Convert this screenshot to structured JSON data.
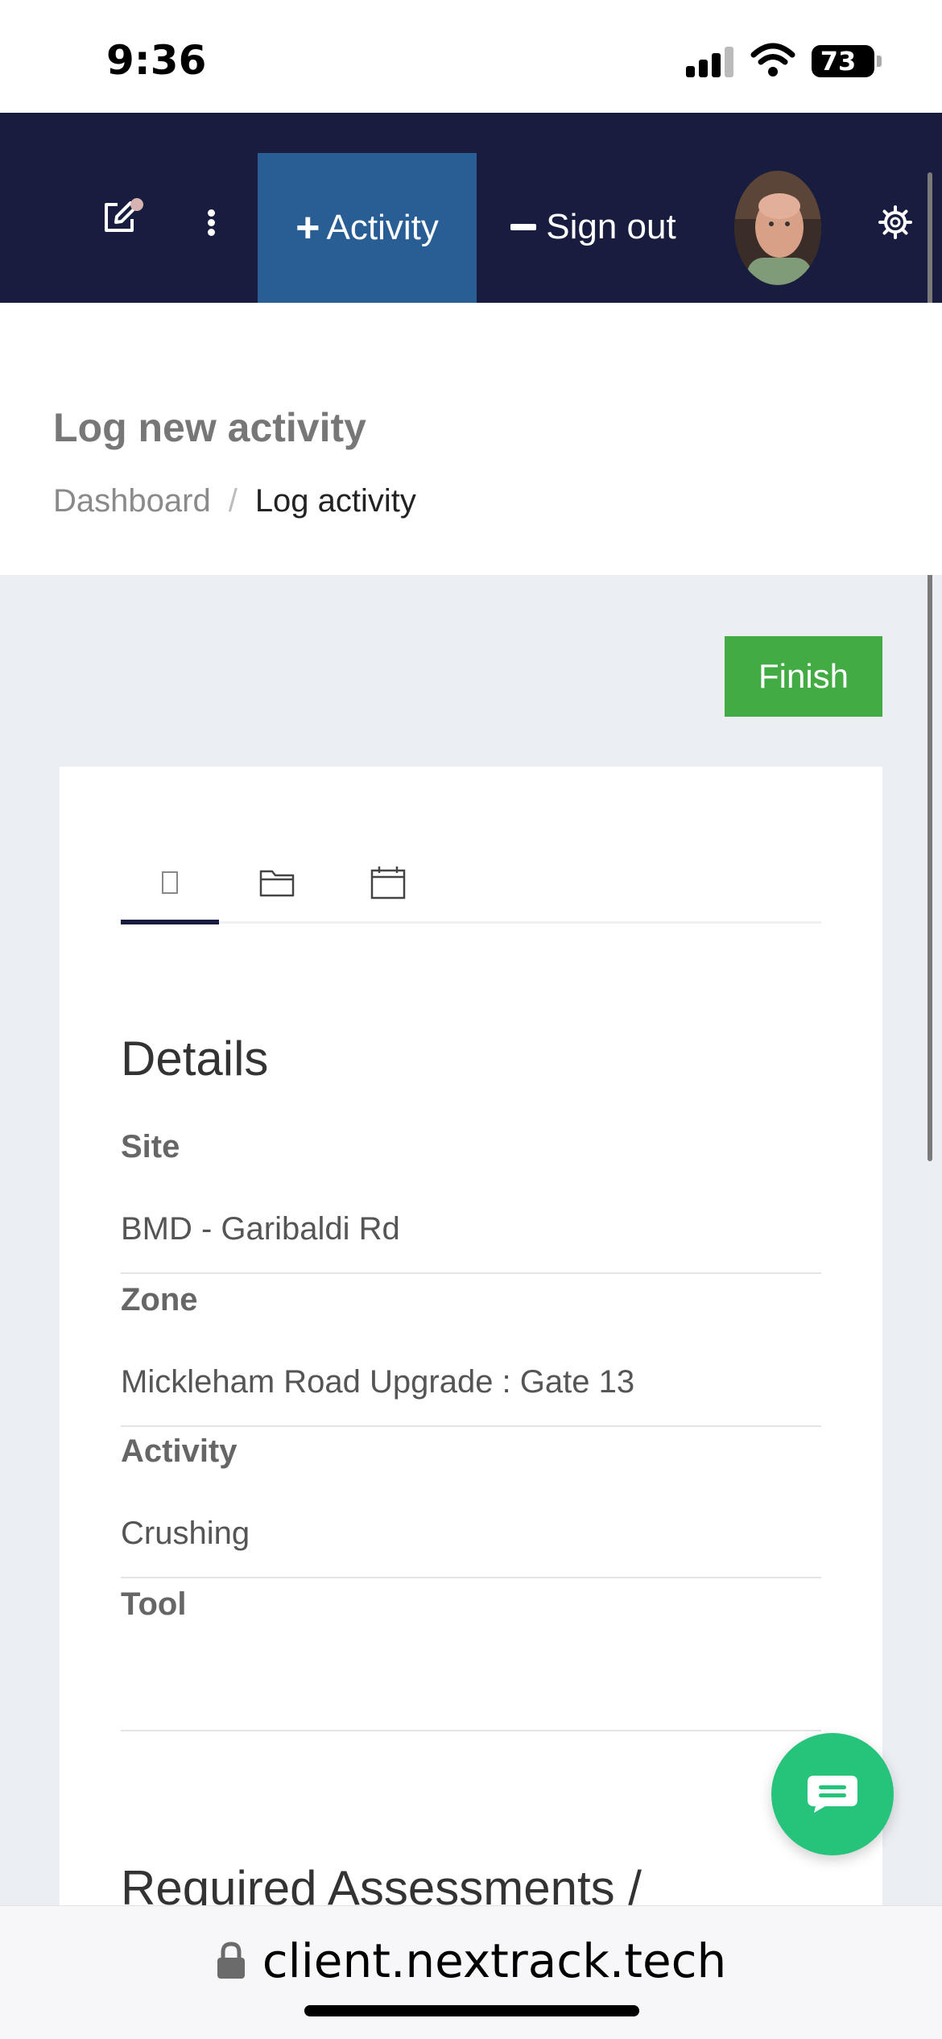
{
  "status_bar": {
    "time": "9:36",
    "battery": "73"
  },
  "nav": {
    "activity_label": "Activity",
    "signout_label": "Sign out",
    "icons": [
      "edit-icon",
      "more-vertical-icon",
      "plus-icon",
      "minus-icon",
      "gear-icon"
    ]
  },
  "page": {
    "title": "Log new activity",
    "breadcrumb": {
      "home": "Dashboard",
      "separator": "/",
      "current": "Log activity"
    }
  },
  "finish_label": "Finish",
  "tabs": [
    {
      "icon": "details-icon",
      "active": true
    },
    {
      "icon": "folder-icon",
      "active": false
    },
    {
      "icon": "calendar-icon",
      "active": false
    }
  ],
  "details": {
    "title": "Details",
    "fields": [
      {
        "label": "Site",
        "value": "BMD - Garibaldi Rd"
      },
      {
        "label": "Zone",
        "value": "Mickleham Road Upgrade : Gate 13"
      },
      {
        "label": "Activity",
        "value": "Crushing"
      },
      {
        "label": "Tool",
        "value": ""
      }
    ]
  },
  "next_section_title": "Required Assessments /",
  "browser": {
    "url": "client.nextrack.tech"
  },
  "colors": {
    "nav_bg": "#181c3e",
    "activity_button": "#285e94",
    "finish_button": "#43ab44",
    "chat_button": "#26c37a",
    "page_bg": "#ebeef3"
  }
}
